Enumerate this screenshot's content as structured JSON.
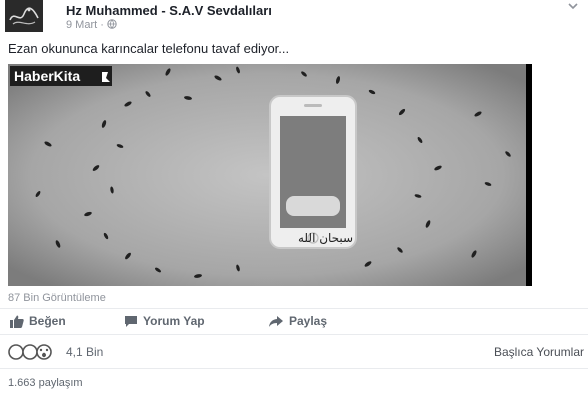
{
  "post": {
    "author": "Hz Muhammed - S.A.V Sevdalıları",
    "date": "9 Mart",
    "caption": "Ezan okununca karıncalar telefonu tavaf ediyor...",
    "video_watermark": "HaberKita",
    "video_overlay_text": "سبحان الله",
    "views": "87 Bin Görüntüleme"
  },
  "actions": {
    "like": "Beğen",
    "comment": "Yorum Yap",
    "share": "Paylaş"
  },
  "reactions": {
    "count": "4,1 Bin",
    "top_comments": "Başlıca Yorumlar"
  },
  "shares": "1.663 paylaşım",
  "colors": {
    "text": "#1d2129",
    "secondary": "#90949c",
    "action": "#606770",
    "divider": "#e9ebee"
  }
}
